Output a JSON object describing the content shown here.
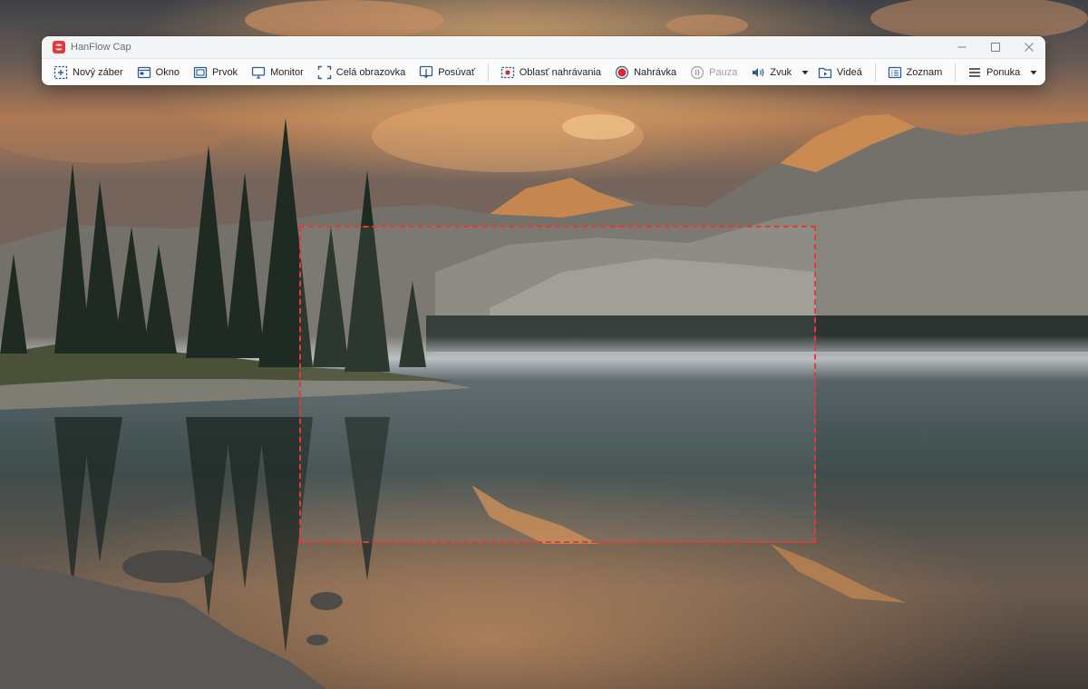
{
  "app": {
    "title": "HanFlow Cap"
  },
  "window_controls": {
    "minimize": "minimize-icon",
    "maximize": "maximize-icon",
    "close": "close-icon"
  },
  "toolbar": {
    "new_capture": "Nový záber",
    "window": "Okno",
    "element": "Prvok",
    "monitor": "Monitor",
    "full_screen": "Celá obrazovka",
    "scroll": "Posúvať",
    "record_area": "Oblasť nahrávania",
    "record": "Nahrávka",
    "pause": "Pauza",
    "sound": "Zvuk",
    "videos": "Videá",
    "list": "Zoznam",
    "menu": "Ponuka"
  },
  "colors": {
    "accent": "#e53935",
    "record": "#d92b2b",
    "toolbar_icon": "#2f5c8f"
  },
  "state": {
    "pause_enabled": false
  }
}
